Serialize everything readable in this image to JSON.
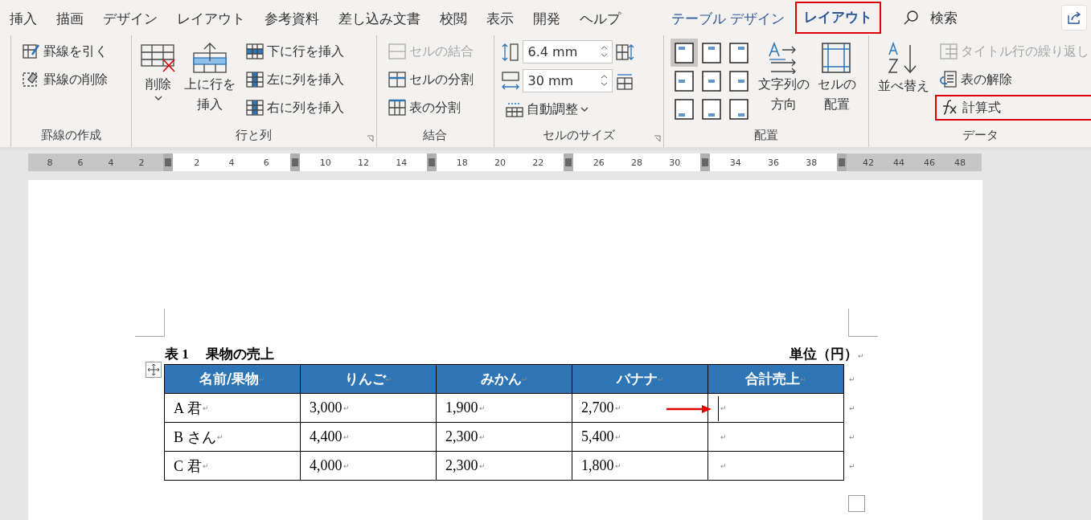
{
  "tabs": [
    {
      "label": "挿入",
      "selected": false,
      "kind": "main",
      "highlighted": false
    },
    {
      "label": "描画",
      "selected": false,
      "kind": "main",
      "highlighted": false
    },
    {
      "label": "デザイン",
      "selected": false,
      "kind": "main",
      "highlighted": false
    },
    {
      "label": "レイアウト",
      "selected": false,
      "kind": "main",
      "highlighted": false
    },
    {
      "label": "参考資料",
      "selected": false,
      "kind": "main",
      "highlighted": false
    },
    {
      "label": "差し込み文書",
      "selected": false,
      "kind": "main",
      "highlighted": false
    },
    {
      "label": "校閲",
      "selected": false,
      "kind": "main",
      "highlighted": false
    },
    {
      "label": "表示",
      "selected": false,
      "kind": "main",
      "highlighted": false
    },
    {
      "label": "開発",
      "selected": false,
      "kind": "main",
      "highlighted": false
    },
    {
      "label": "ヘルプ",
      "selected": false,
      "kind": "main",
      "highlighted": false
    },
    {
      "label": "テーブル デザイン",
      "selected": false,
      "kind": "context",
      "highlighted": false
    },
    {
      "label": "レイアウト",
      "selected": true,
      "kind": "context",
      "highlighted": true
    }
  ],
  "search": {
    "label": "検索"
  },
  "ribbon": {
    "groups": [
      {
        "label": "罫線の作成",
        "launcher": false,
        "columns": [
          [
            {
              "kind": "small",
              "label": "罫線を引く",
              "disabled": false,
              "highlighted": false
            },
            {
              "kind": "small",
              "label": "罫線の削除",
              "disabled": false,
              "highlighted": false
            }
          ]
        ]
      },
      {
        "label": "行と列",
        "launcher": true,
        "columns": [
          [
            {
              "kind": "large",
              "lines": [
                "削除"
              ],
              "dropdown": true
            }
          ],
          [
            {
              "kind": "large",
              "lines": [
                "上に行を",
                "挿入"
              ],
              "dropdown": false
            }
          ],
          [
            {
              "kind": "small",
              "label": "下に行を挿入",
              "disabled": false,
              "highlighted": false
            },
            {
              "kind": "small",
              "label": "左に列を挿入",
              "disabled": false,
              "highlighted": false
            },
            {
              "kind": "small",
              "label": "右に列を挿入",
              "disabled": false,
              "highlighted": false
            }
          ]
        ]
      },
      {
        "label": "結合",
        "launcher": false,
        "columns": [
          [
            {
              "kind": "small",
              "label": "セルの結合",
              "disabled": true,
              "highlighted": false
            },
            {
              "kind": "small",
              "label": "セルの分割",
              "disabled": false,
              "highlighted": false
            },
            {
              "kind": "small",
              "label": "表の分割",
              "disabled": false,
              "highlighted": false
            }
          ]
        ]
      },
      {
        "label": "セルのサイズ",
        "launcher": true,
        "columns": [
          [
            {
              "kind": "spin",
              "value": "6.4 mm"
            },
            {
              "kind": "spin",
              "value": "30 mm"
            },
            {
              "kind": "small",
              "label": "自動調整",
              "disabled": false,
              "highlighted": false,
              "dropdown": true
            }
          ]
        ]
      },
      {
        "label": "配置",
        "launcher": false,
        "columns": [
          [
            {
              "kind": "align",
              "cells": [
                {
                  "selected": true
                },
                {
                  "selected": false
                },
                {
                  "selected": false
                },
                {
                  "selected": false
                },
                {
                  "selected": false
                },
                {
                  "selected": false
                },
                {
                  "selected": false
                },
                {
                  "selected": false
                },
                {
                  "selected": false
                }
              ]
            }
          ],
          [
            {
              "kind": "large",
              "lines": [
                "文字列の",
                "方向"
              ],
              "dropdown": false
            }
          ],
          [
            {
              "kind": "large",
              "lines": [
                "セルの",
                "配置"
              ],
              "dropdown": false
            }
          ]
        ]
      },
      {
        "label": "データ",
        "launcher": false,
        "columns": [
          [
            {
              "kind": "large",
              "lines": [
                "並べ替え"
              ],
              "dropdown": false
            }
          ],
          [
            {
              "kind": "small",
              "label": "タイトル行の繰り返し",
              "disabled": true,
              "highlighted": false
            },
            {
              "kind": "small",
              "label": "表の解除",
              "disabled": false,
              "highlighted": false
            },
            {
              "kind": "small",
              "label": "計算式",
              "disabled": false,
              "highlighted": true
            }
          ]
        ]
      }
    ]
  },
  "ruler": {
    "segments": [
      {
        "kind": "margin",
        "ticks": [
          "8",
          "6",
          "4",
          "2"
        ]
      },
      {
        "kind": "column",
        "ticks": [
          "2",
          "4",
          "6"
        ]
      },
      {
        "kind": "column",
        "ticks": [
          "10",
          "12",
          "14"
        ]
      },
      {
        "kind": "column",
        "ticks": [
          "18",
          "20",
          "22"
        ]
      },
      {
        "kind": "column",
        "ticks": [
          "26",
          "28",
          "30"
        ]
      },
      {
        "kind": "column",
        "ticks": [
          "34",
          "36",
          "38"
        ]
      },
      {
        "kind": "margin",
        "ticks": [
          "42",
          "44",
          "46",
          "48"
        ]
      }
    ]
  },
  "document": {
    "caption": {
      "title": "表 1　 果物の売上",
      "unit": "単位（円）",
      "mark": "↵"
    },
    "table": {
      "columns": [
        {
          "label": "名前/果物",
          "mark": "↵"
        },
        {
          "label": "りんご",
          "mark": "↵"
        },
        {
          "label": "みかん",
          "mark": "↵"
        },
        {
          "label": "バナナ",
          "mark": "↵"
        },
        {
          "label": "合計売上",
          "mark": "↵"
        }
      ],
      "header_end_mark": "↵",
      "rows": [
        {
          "end_mark": "↵",
          "cells": [
            {
              "text": "A 君",
              "mark": "↵",
              "arrow": false
            },
            {
              "text": "3,000",
              "mark": "↵",
              "arrow": false
            },
            {
              "text": "1,900",
              "mark": "↵",
              "arrow": false
            },
            {
              "text": "2,700",
              "mark": "↵",
              "arrow": false
            },
            {
              "mark": "↵",
              "arrow": true
            }
          ]
        },
        {
          "end_mark": "↵",
          "cells": [
            {
              "text": "B さん",
              "mark": "↵",
              "arrow": false
            },
            {
              "text": "4,400",
              "mark": "↵",
              "arrow": false
            },
            {
              "text": "2,300",
              "mark": "↵",
              "arrow": false
            },
            {
              "text": "5,400",
              "mark": "↵",
              "arrow": false
            },
            {
              "mark": "↵",
              "arrow": false
            }
          ]
        },
        {
          "end_mark": "↵",
          "cells": [
            {
              "text": "C 君",
              "mark": "↵",
              "arrow": false
            },
            {
              "text": "4,000",
              "mark": "↵",
              "arrow": false
            },
            {
              "text": "2,300",
              "mark": "↵",
              "arrow": false
            },
            {
              "text": "1,800",
              "mark": "↵",
              "arrow": false
            },
            {
              "mark": "↵",
              "arrow": false
            }
          ]
        }
      ]
    }
  }
}
